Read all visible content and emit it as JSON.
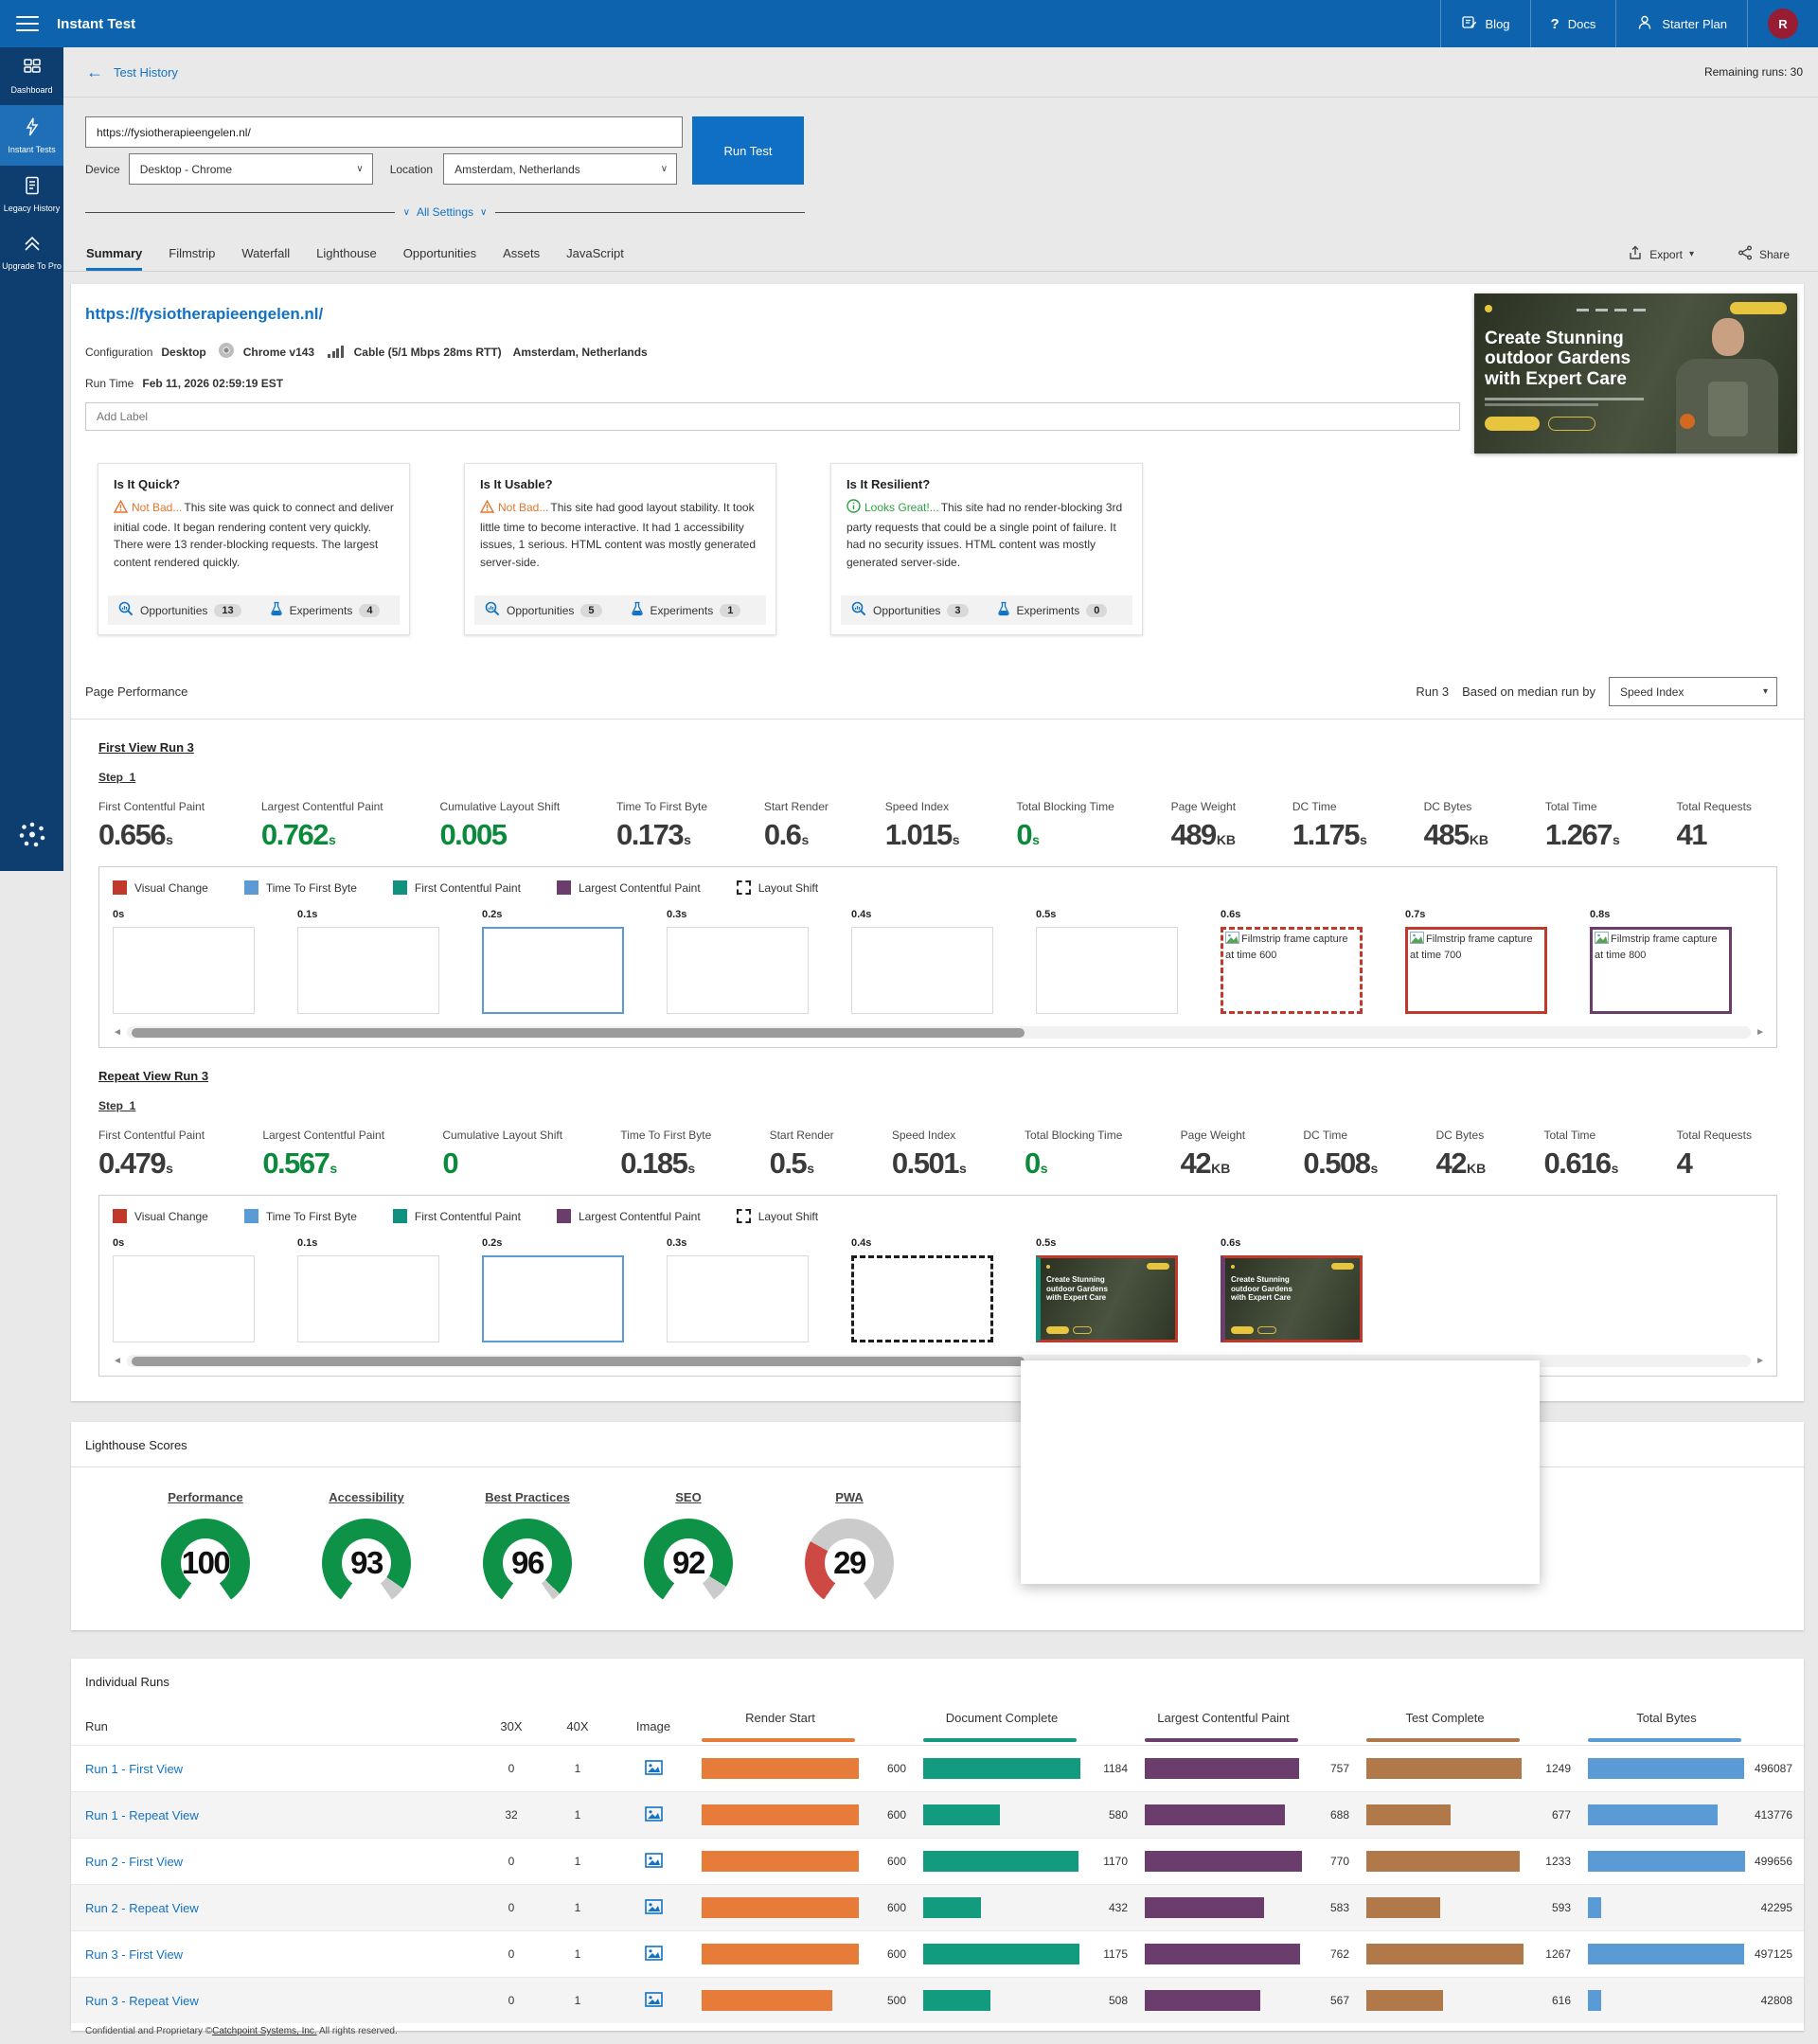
{
  "header": {
    "title": "Instant Test",
    "nav": [
      {
        "label": "Blog"
      },
      {
        "label": "Docs"
      },
      {
        "label": "Starter Plan"
      }
    ],
    "avatar_initial": "R"
  },
  "subheader": {
    "back_label": "Test History",
    "remaining_runs": "Remaining runs: 30"
  },
  "sidebar": {
    "items": [
      {
        "label": "Dashboard"
      },
      {
        "label": "Instant Tests"
      },
      {
        "label": "Legacy History"
      },
      {
        "label": "Upgrade To Pro"
      }
    ]
  },
  "test_form": {
    "url": "https://fysiotherapieengelen.nl/",
    "device_label": "Device",
    "device_value": "Desktop - Chrome",
    "location_label": "Location",
    "location_value": "Amsterdam, Netherlands",
    "run_button_label": "Run Test",
    "all_settings_label": "All Settings"
  },
  "tabs": {
    "active_index": 0,
    "items": [
      "Summary",
      "Filmstrip",
      "Waterfall",
      "Lighthouse",
      "Opportunities",
      "Assets",
      "JavaScript"
    ]
  },
  "actions": {
    "export_label": "Export",
    "share_label": "Share"
  },
  "summary": {
    "url": "https://fysiotherapieengelen.nl/",
    "config_label": "Configuration",
    "config_device": "Desktop",
    "config_browser": "Chrome v143",
    "config_network": "Cable (5/1 Mbps 28ms RTT)",
    "config_location": "Amsterdam, Netherlands",
    "runtime_label": "Run Time",
    "runtime_value": "Feb 11, 2026 02:59:19 EST",
    "label_placeholder": "Add Label",
    "hero": {
      "title": "Create Stunning outdoor Gardens with Expert Care"
    },
    "cards": [
      {
        "title": "Is It Quick?",
        "verdict": "Not Bad...",
        "verdict_type": "warn",
        "text": "This site was quick to connect and deliver initial code. It began rendering content very quickly. There were 13 render-blocking requests. The largest content rendered quickly.",
        "opportunities_label": "Opportunities",
        "opportunities": "13",
        "experiments_label": "Experiments",
        "experiments": "4"
      },
      {
        "title": "Is It Usable?",
        "verdict": "Not Bad...",
        "verdict_type": "warn",
        "text": "This site had good layout stability. It took little time to become interactive. It had 1 accessibility issues, 1 serious. HTML content was mostly generated server-side.",
        "opportunities_label": "Opportunities",
        "opportunities": "5",
        "experiments_label": "Experiments",
        "experiments": "1"
      },
      {
        "title": "Is It Resilient?",
        "verdict": "Looks Great!...",
        "verdict_type": "good",
        "text": "This site had no render-blocking 3rd party requests that could be a single point of failure. It had no security issues. HTML content was mostly generated server-side.",
        "opportunities_label": "Opportunities",
        "opportunities": "3",
        "experiments_label": "Experiments",
        "experiments": "0"
      }
    ]
  },
  "page_performance": {
    "title": "Page Performance",
    "run_label": "Run 3",
    "median_label": "Based on median run by",
    "median_metric": "Speed Index",
    "legend": [
      {
        "label": "Visual Change",
        "color": "#c0392b",
        "style": "solid"
      },
      {
        "label": "Time To First Byte",
        "color": "#5b9bd5",
        "style": "solid"
      },
      {
        "label": "First Contentful Paint",
        "color": "#12917e",
        "style": "solid"
      },
      {
        "label": "Largest Contentful Paint",
        "color": "#6a3d6d",
        "style": "solid"
      },
      {
        "label": "Layout Shift",
        "color": "#222222",
        "style": "dashed"
      }
    ],
    "views": [
      {
        "name": "First View Run 3",
        "step": "Step_1",
        "metrics": [
          {
            "label": "First Contentful Paint",
            "value": "0.656",
            "unit": "s",
            "good": false
          },
          {
            "label": "Largest Contentful Paint",
            "value": "0.762",
            "unit": "s",
            "good": true
          },
          {
            "label": "Cumulative Layout Shift",
            "value": "0.005",
            "unit": "",
            "good": true
          },
          {
            "label": "Time To First Byte",
            "value": "0.173",
            "unit": "s",
            "good": false
          },
          {
            "label": "Start Render",
            "value": "0.6",
            "unit": "s",
            "good": false
          },
          {
            "label": "Speed Index",
            "value": "1.015",
            "unit": "s",
            "good": false
          },
          {
            "label": "Total Blocking Time",
            "value": "0",
            "unit": "s",
            "good": true
          },
          {
            "label": "Page Weight",
            "value": "489",
            "unit": "KB",
            "good": false
          },
          {
            "label": "DC Time",
            "value": "1.175",
            "unit": "s",
            "good": false
          },
          {
            "label": "DC Bytes",
            "value": "485",
            "unit": "KB",
            "good": false
          },
          {
            "label": "Total Time",
            "value": "1.267",
            "unit": "s",
            "good": false
          },
          {
            "label": "Total Requests",
            "value": "41",
            "unit": "",
            "good": false
          }
        ],
        "filmstrip": {
          "frames": [
            {
              "time": "0s",
              "style": "default"
            },
            {
              "time": "0.1s",
              "style": "default"
            },
            {
              "time": "0.2s",
              "style": "ttfb"
            },
            {
              "time": "0.3s",
              "style": "default"
            },
            {
              "time": "0.4s",
              "style": "default"
            },
            {
              "time": "0.5s",
              "style": "default"
            },
            {
              "time": "0.6s",
              "style": "visual-shift",
              "alt": "Filmstrip frame capture at time 600"
            },
            {
              "time": "0.7s",
              "style": "visual",
              "alt": "Filmstrip frame capture at time 700"
            },
            {
              "time": "0.8s",
              "style": "lcp",
              "alt": "Filmstrip frame capture at time 800"
            }
          ]
        }
      },
      {
        "name": "Repeat View Run 3",
        "step": "Step_1",
        "metrics": [
          {
            "label": "First Contentful Paint",
            "value": "0.479",
            "unit": "s",
            "good": false
          },
          {
            "label": "Largest Contentful Paint",
            "value": "0.567",
            "unit": "s",
            "good": true
          },
          {
            "label": "Cumulative Layout Shift",
            "value": "0",
            "unit": "",
            "good": true
          },
          {
            "label": "Time To First Byte",
            "value": "0.185",
            "unit": "s",
            "good": false
          },
          {
            "label": "Start Render",
            "value": "0.5",
            "unit": "s",
            "good": false
          },
          {
            "label": "Speed Index",
            "value": "0.501",
            "unit": "s",
            "good": false
          },
          {
            "label": "Total Blocking Time",
            "value": "0",
            "unit": "s",
            "good": true
          },
          {
            "label": "Page Weight",
            "value": "42",
            "unit": "KB",
            "good": false
          },
          {
            "label": "DC Time",
            "value": "0.508",
            "unit": "s",
            "good": false
          },
          {
            "label": "DC Bytes",
            "value": "42",
            "unit": "KB",
            "good": false
          },
          {
            "label": "Total Time",
            "value": "0.616",
            "unit": "s",
            "good": false
          },
          {
            "label": "Total Requests",
            "value": "4",
            "unit": "",
            "good": false
          }
        ],
        "filmstrip": {
          "frames": [
            {
              "time": "0s",
              "style": "default"
            },
            {
              "time": "0.1s",
              "style": "default"
            },
            {
              "time": "0.2s",
              "style": "ttfb"
            },
            {
              "time": "0.3s",
              "style": "default"
            },
            {
              "time": "0.4s",
              "style": "shift"
            },
            {
              "time": "0.5s",
              "style": "fcp-visual",
              "image": true
            },
            {
              "time": "0.6s",
              "style": "lcp-visual",
              "image": true
            }
          ]
        }
      }
    ]
  },
  "lighthouse": {
    "title": "Lighthouse Scores",
    "gauges": [
      {
        "label": "Performance",
        "score": 100,
        "color": "#0e9247"
      },
      {
        "label": "Accessibility",
        "score": 93,
        "color": "#0e9247"
      },
      {
        "label": "Best Practices",
        "score": 96,
        "color": "#0e9247"
      },
      {
        "label": "SEO",
        "score": 92,
        "color": "#0e9247"
      },
      {
        "label": "PWA",
        "score": 29,
        "color": "#cf4944"
      }
    ]
  },
  "individual_runs": {
    "title": "Individual Runs",
    "left_columns": [
      "Run",
      "30X",
      "40X",
      "Image"
    ],
    "metric_columns": [
      {
        "label": "Render Start",
        "color": "#e77b3a",
        "key": "render_start"
      },
      {
        "label": "Document Complete",
        "color": "#139b80",
        "key": "doc_complete"
      },
      {
        "label": "Largest Contentful Paint",
        "color": "#6a3d6d",
        "key": "lcp"
      },
      {
        "label": "Test Complete",
        "color": "#b1794a",
        "key": "test_complete"
      },
      {
        "label": "Total Bytes",
        "color": "#5b9bd5",
        "key": "total_bytes"
      }
    ],
    "rows": [
      {
        "run": "Run 1 - First View",
        "x30": "0",
        "x40": "1",
        "render_start": 600,
        "doc_complete": 1184,
        "lcp": 757,
        "test_complete": 1249,
        "total_bytes": 496087
      },
      {
        "run": "Run 1 - Repeat View",
        "x30": "32",
        "x40": "1",
        "render_start": 600,
        "doc_complete": 580,
        "lcp": 688,
        "test_complete": 677,
        "total_bytes": 413776
      },
      {
        "run": "Run 2 - First View",
        "x30": "0",
        "x40": "1",
        "render_start": 600,
        "doc_complete": 1170,
        "lcp": 770,
        "test_complete": 1233,
        "total_bytes": 499656
      },
      {
        "run": "Run 2 - Repeat View",
        "x30": "0",
        "x40": "1",
        "render_start": 600,
        "doc_complete": 432,
        "lcp": 583,
        "test_complete": 593,
        "total_bytes": 42295
      },
      {
        "run": "Run 3 - First View",
        "x30": "0",
        "x40": "1",
        "render_start": 600,
        "doc_complete": 1175,
        "lcp": 762,
        "test_complete": 1267,
        "total_bytes": 497125
      },
      {
        "run": "Run 3 - Repeat View",
        "x30": "0",
        "x40": "1",
        "render_start": 500,
        "doc_complete": 508,
        "lcp": 567,
        "test_complete": 616,
        "total_bytes": 42808
      }
    ]
  },
  "footer": {
    "prefix": "Confidential and Proprietary ©",
    "link": "Catchpoint Systems, Inc.",
    "suffix": " All rights reserved."
  }
}
